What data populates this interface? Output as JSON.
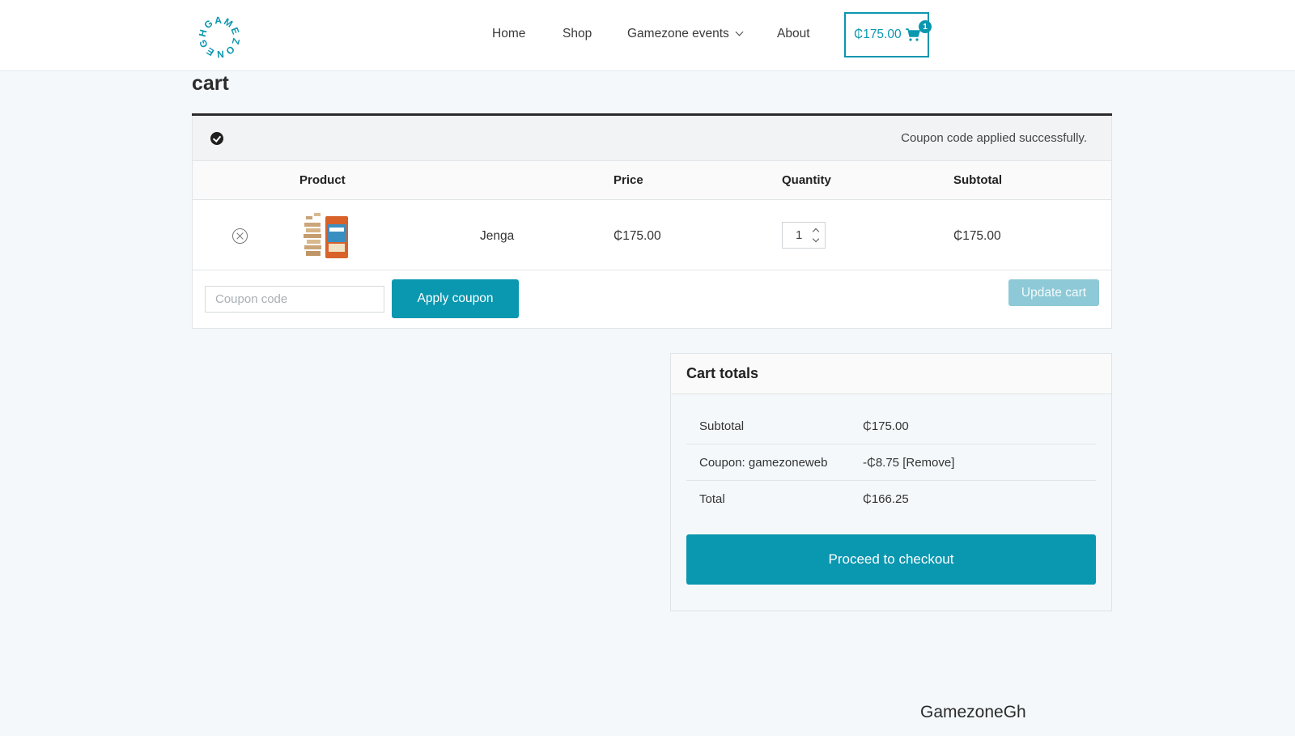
{
  "site": {
    "logo_text": "GAMEZONEGH",
    "footer_brand": "GamezoneGh"
  },
  "nav": {
    "items": [
      "Home",
      "Shop",
      "Gamezone events",
      "About"
    ],
    "cart_total": "₵175.00",
    "cart_count": "1"
  },
  "page": {
    "title": "cart"
  },
  "notice": {
    "message": "Coupon code applied successfully."
  },
  "cart_table": {
    "headers": {
      "product": "Product",
      "price": "Price",
      "quantity": "Quantity",
      "subtotal": "Subtotal"
    },
    "rows": [
      {
        "name": "Jenga",
        "price": "₵175.00",
        "quantity": "1",
        "subtotal": "₵175.00"
      }
    ],
    "coupon_placeholder": "Coupon code",
    "apply_coupon_label": "Apply coupon",
    "update_cart_label": "Update cart"
  },
  "totals": {
    "title": "Cart totals",
    "subtotal_label": "Subtotal",
    "subtotal_value": "₵175.00",
    "coupon_label": "Coupon: gamezoneweb",
    "coupon_value": "-₵8.75",
    "coupon_remove": "[Remove]",
    "total_label": "Total",
    "total_value": "₵166.25",
    "checkout_label": "Proceed to checkout"
  },
  "colors": {
    "accent": "#0a97b0",
    "accent_disabled": "#8dc9d6",
    "page_background": "#f4f8fb"
  }
}
